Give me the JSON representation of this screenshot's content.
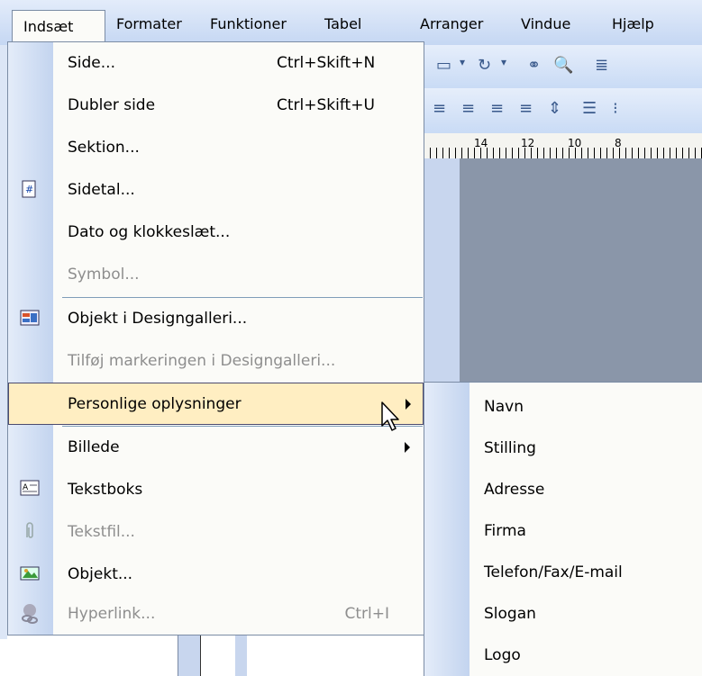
{
  "menubar": {
    "items": [
      {
        "label": "Indsæt",
        "active": true
      },
      {
        "label": "Formater"
      },
      {
        "label": "Funktioner"
      },
      {
        "label": "Tabel"
      },
      {
        "label": "Arranger"
      },
      {
        "label": "Vindue"
      },
      {
        "label": "Hjælp"
      }
    ]
  },
  "ruler": {
    "labels": [
      "14",
      "12",
      "10",
      "8"
    ]
  },
  "insert_menu": {
    "items": [
      {
        "label": "Side...",
        "shortcut": "Ctrl+Skift+N"
      },
      {
        "label": "Dubler side",
        "shortcut": "Ctrl+Skift+U"
      },
      {
        "label": "Sektion..."
      },
      {
        "label": "Sidetal...",
        "icon": "page-number-icon"
      },
      {
        "label": "Dato og klokkeslæt..."
      },
      {
        "label": "Symbol...",
        "disabled": true
      },
      {
        "label": "Objekt i Designgalleri...",
        "icon": "design-gallery-icon"
      },
      {
        "label": "Tilføj markeringen i Designgalleri...",
        "disabled": true
      },
      {
        "label": "Personlige oplysninger",
        "submenu": true,
        "highlighted": true
      },
      {
        "label": "Billede",
        "submenu": true
      },
      {
        "label": "Tekstboks",
        "icon": "text-box-icon"
      },
      {
        "label": "Tekstfil...",
        "icon": "paperclip-icon",
        "disabled": true
      },
      {
        "label": "Objekt...",
        "icon": "object-icon"
      },
      {
        "label": "Hyperlink...",
        "icon": "hyperlink-icon",
        "shortcut": "Ctrl+I",
        "disabled": true
      }
    ]
  },
  "personal_info_submenu": {
    "items": [
      {
        "label": "Navn"
      },
      {
        "label": "Stilling"
      },
      {
        "label": "Adresse"
      },
      {
        "label": "Firma"
      },
      {
        "label": "Telefon/Fax/E-mail"
      },
      {
        "label": "Slogan"
      },
      {
        "label": "Logo"
      }
    ]
  }
}
